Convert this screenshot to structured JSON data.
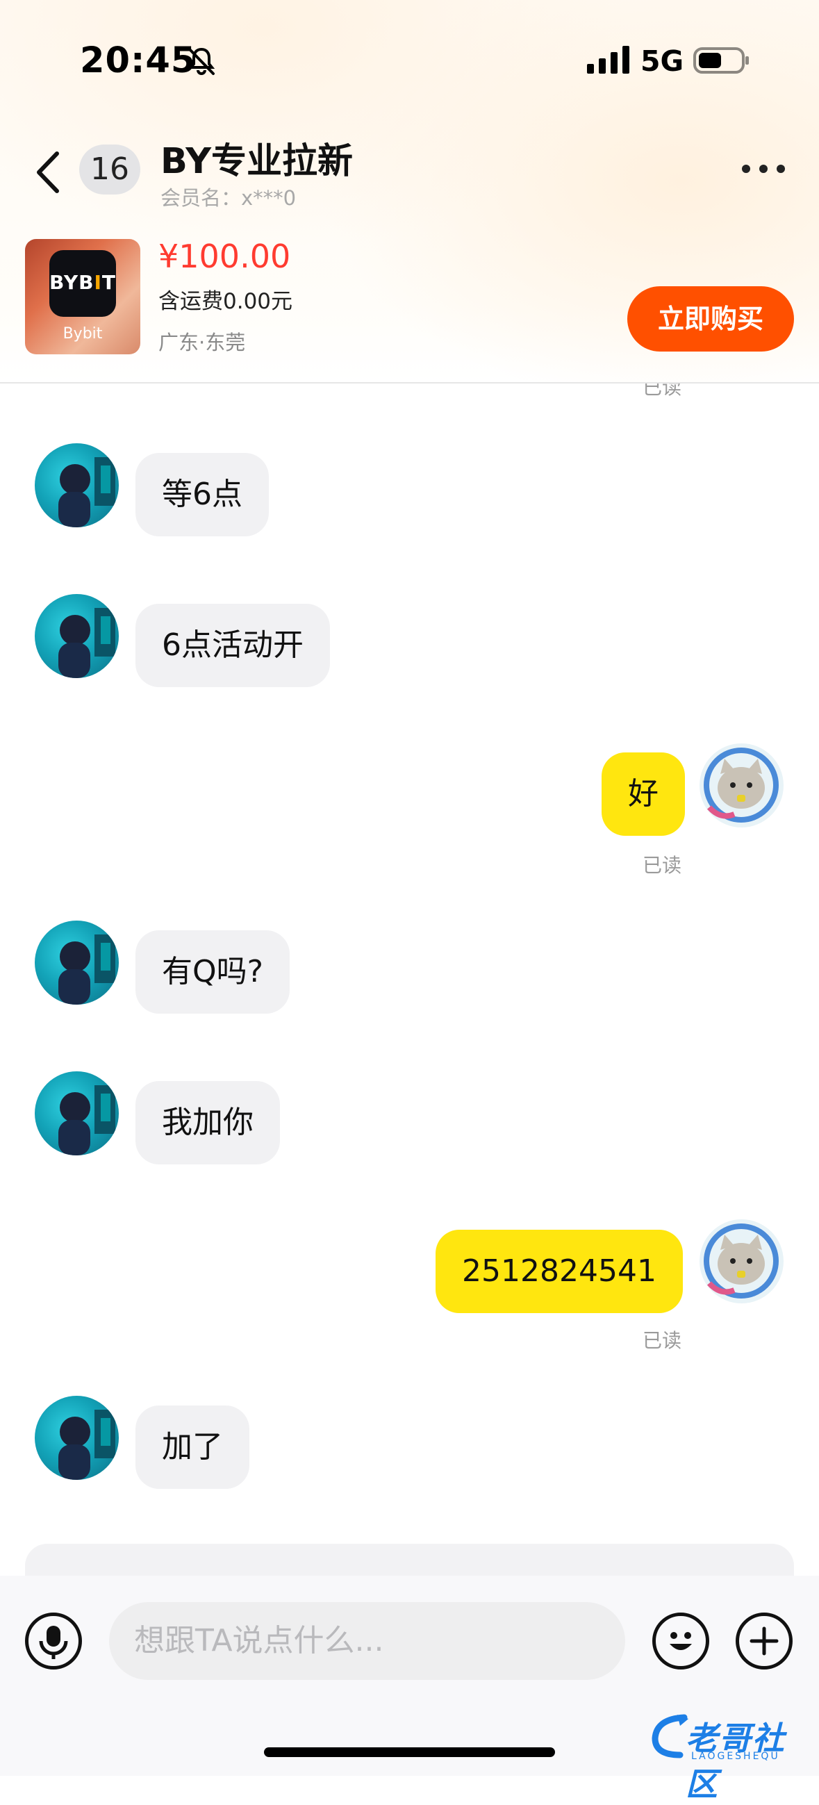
{
  "status_bar": {
    "time": "20:45",
    "network": "5G"
  },
  "header": {
    "unread_count": "16",
    "title": "BY专业拉新",
    "member_label": "会员名：x***0"
  },
  "product": {
    "logo_text_a": "BYB",
    "logo_text_b": "I",
    "logo_text_c": "T",
    "brand": "Bybit",
    "price": "¥100.00",
    "shipping": "含运费0.00元",
    "location": "广东·东莞",
    "buy_label": "立即购买"
  },
  "messages": [
    {
      "side": "in",
      "text": "等6点"
    },
    {
      "side": "in",
      "text": "6点活动开"
    },
    {
      "side": "out",
      "text": "好",
      "status": "已读"
    },
    {
      "side": "in",
      "text": "有Q吗?"
    },
    {
      "side": "in",
      "text": "我加你"
    },
    {
      "side": "out",
      "text": "2512824541",
      "status": "已读"
    },
    {
      "side": "in",
      "text": "加了"
    }
  ],
  "top_read_status": "已读",
  "input": {
    "placeholder": "想跟TA说点什么..."
  },
  "watermark": {
    "text": "老哥社区",
    "sub": "LAOGESHEQU"
  },
  "colors": {
    "accent": "#ff5000",
    "price": "#ff3b30",
    "outgoing_bubble": "#ffe60f",
    "incoming_bubble": "#f1f1f3"
  }
}
